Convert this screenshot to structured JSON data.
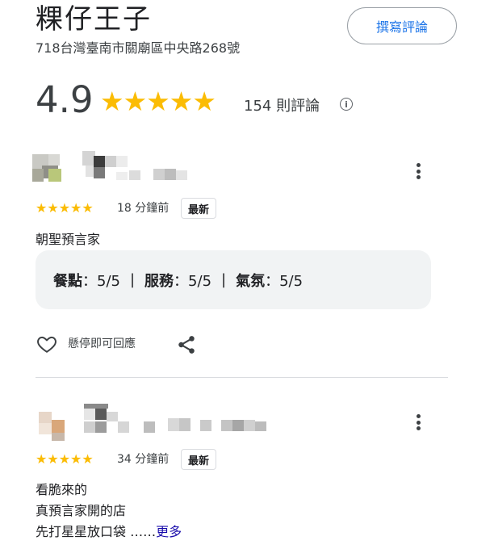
{
  "header": {
    "title": "粿仔王子",
    "address": "718台灣臺南市關廟區中央路268號",
    "write_review_label": "撰寫評論"
  },
  "summary": {
    "rating": "4.9",
    "stars": "★★★★★",
    "review_count": "154 則評論",
    "info_icon": "i"
  },
  "reviews": [
    {
      "stars": "★★★★★",
      "time": "18 分鐘前",
      "badge": "最新",
      "text_lines": [
        "朝聖預言家"
      ],
      "scores": {
        "food_label": "餐點",
        "food_value": "：5/5",
        "service_label": "服務",
        "service_value": "：5/5",
        "atmosphere_label": "氣氛",
        "atmosphere_value": "：5/5",
        "separator": "|"
      },
      "like_label": "懸停即可回應"
    },
    {
      "stars": "★★★★★",
      "time": "34 分鐘前",
      "badge": "最新",
      "text_lines": [
        "看脆來的",
        "真預言家開的店",
        "先打星星放口袋 ……"
      ],
      "more_label": "更多"
    }
  ],
  "icons": {
    "info": "info-icon",
    "more": "more-vert-icon",
    "heart": "heart-outline-icon",
    "share": "share-icon"
  },
  "colors": {
    "star": "#fbbc04",
    "accent": "#1a73e8",
    "link": "#1a0dab",
    "card_bg": "#f1f3f4"
  }
}
